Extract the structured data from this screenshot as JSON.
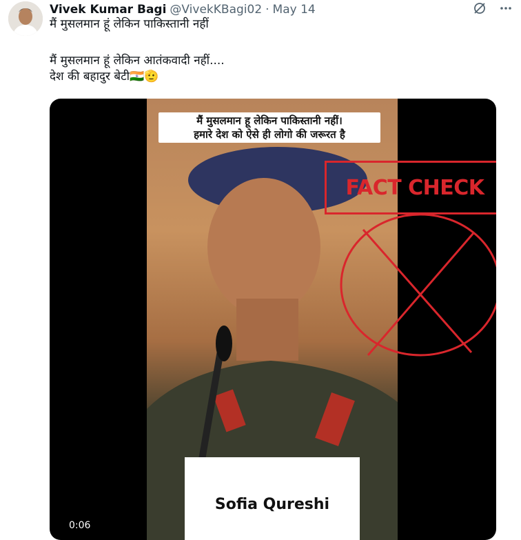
{
  "author": {
    "name": "Vivek Kumar Bagi",
    "handle": "@VivekKBagi02",
    "separator": "·",
    "date": "May 14"
  },
  "icons": {
    "grok": "grok-slash-icon",
    "more": "more-horizontal-icon"
  },
  "tweet": {
    "line1": "मैं मुसलमान हूं लेकिन पाकिस्तानी नहीं",
    "line2": "मैं मुसलमान हूं लेकिन आतंकवादी नहीं....",
    "line3": "देश की बहादुर बेटी🇮🇳🫡"
  },
  "media": {
    "caption_line1": "मैं मुसलमान हू लेकिन पाकिस्तानी नहीं।",
    "caption_line2": "हमारे देश को ऐसे ही लोगो की जरूरत है",
    "nameplate": "Sofia Qureshi",
    "fact_check_label": "FACT CHECK",
    "timestamp": "0:06"
  },
  "colors": {
    "fact_check_red": "#d9262c",
    "name_text": "#0f1419",
    "muted_text": "#536471"
  }
}
